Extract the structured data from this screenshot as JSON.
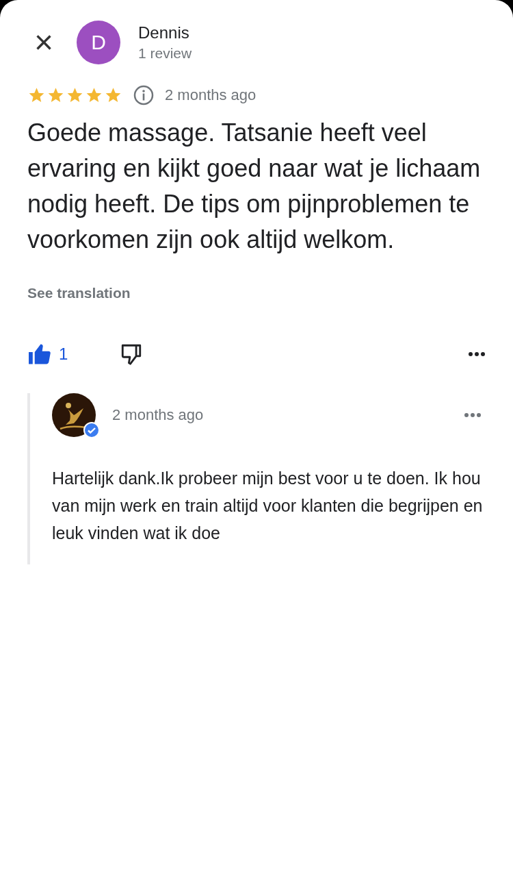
{
  "close_button": "×",
  "reviewer": {
    "initial": "D",
    "name": "Dennis",
    "reviews": "1 review"
  },
  "review": {
    "stars": 5,
    "time": "2 months ago",
    "text": "Goede massage. Tatsanie heeft veel ervaring en kijkt goed naar wat je lichaam nodig heeft. De tips om pijnproblemen te voorkomen zijn ook altijd welkom.",
    "translation_link": "See translation"
  },
  "actions": {
    "likes": "1",
    "liked": true
  },
  "owner_reply": {
    "time": "2 months ago",
    "verified": true,
    "text": "Hartelijk dank.Ik probeer mijn best voor u te doen. Ik hou van mijn werk en train altijd voor klanten die begrijpen en leuk vinden wat ik doe"
  }
}
